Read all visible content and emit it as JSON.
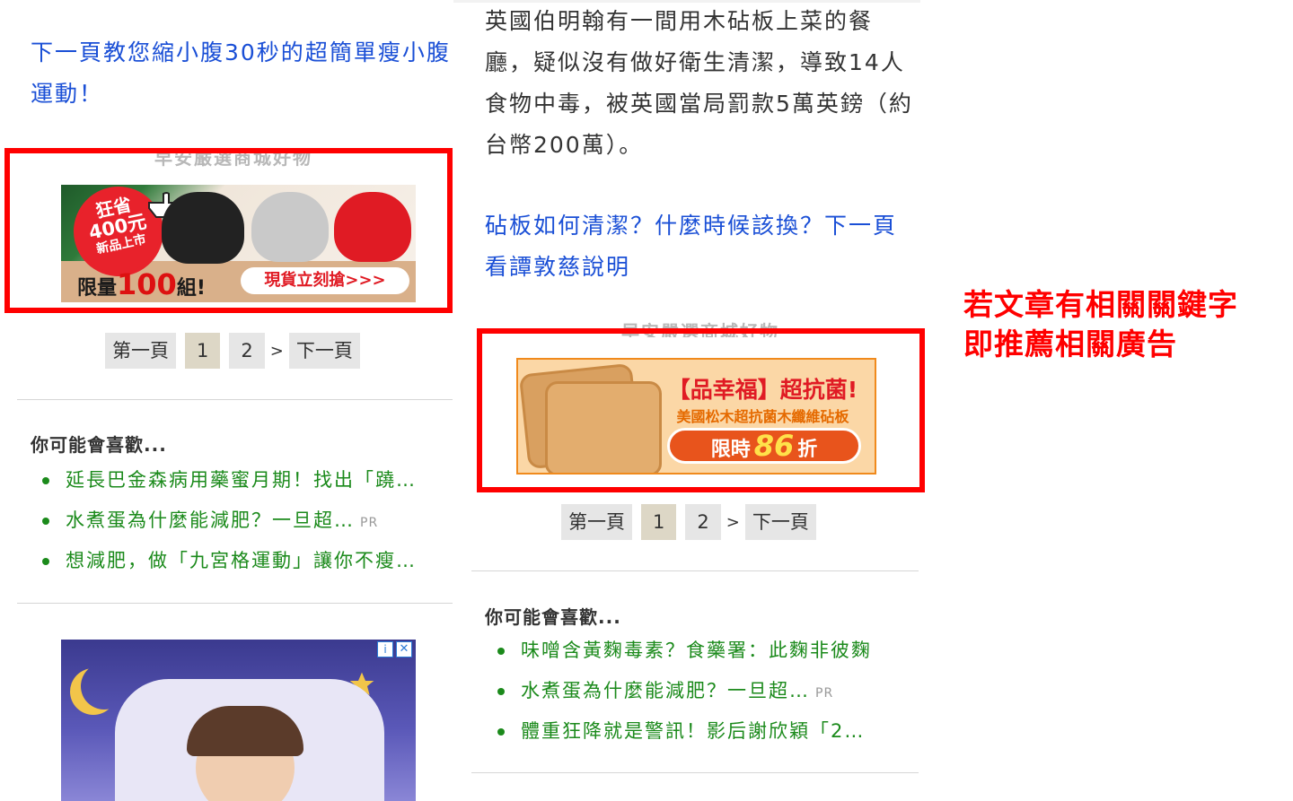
{
  "left": {
    "link_text": "下一頁教您縮小腹30秒的超簡單瘦小腹運動！",
    "ad_caption": "早安嚴選商城好物",
    "ad_banner": {
      "badge_line1": "狂省",
      "badge_line2": "400元",
      "badge_line3": "新品上市",
      "promo_prefix": "限量",
      "promo_number": "100",
      "promo_suffix": "組!",
      "cta_text": "現貨立刻搶>>>"
    },
    "pager": {
      "first": "第一頁",
      "page1": "1",
      "page2": "2",
      "arrow": ">",
      "next": "下一頁"
    },
    "you_may_like": "你可能會喜歡...",
    "related": [
      {
        "text": "延長巴金森病用藥蜜月期！找出「蹺…",
        "pr": ""
      },
      {
        "text": "水煮蛋為什麼能減肥？一旦超…",
        "pr": "PR"
      },
      {
        "text": "想減肥，做「九宮格運動」讓你不瘦…",
        "pr": ""
      }
    ]
  },
  "middle": {
    "paragraph": "英國伯明翰有一間用木砧板上菜的餐廳，疑似沒有做好衛生清潔，導致14人食物中毒，被英國當局罰款5萬英鎊（約台幣200萬）。",
    "link_text": "砧板如何清潔？什麼時候該換？下一頁看譚敦慈說明",
    "ad_caption": "早安嚴選商城好物",
    "ad_banner": {
      "title": "【品幸福】超抗菌!",
      "subtitle": "美國松木超抗菌木纖維砧板",
      "cta_prefix": "限時",
      "cta_number": "86",
      "cta_suffix": "折"
    },
    "pager": {
      "first": "第一頁",
      "page1": "1",
      "page2": "2",
      "arrow": ">",
      "next": "下一頁"
    },
    "you_may_like": "你可能會喜歡...",
    "related": [
      {
        "text": "味噌含黃麴毒素？食藥署：此麴非彼麴",
        "pr": ""
      },
      {
        "text": "水煮蛋為什麼能減肥？一旦超…",
        "pr": "PR"
      },
      {
        "text": "體重狂降就是警訊！影后謝欣穎「2…",
        "pr": ""
      }
    ]
  },
  "annotation": {
    "line1": "若文章有相關關鍵字",
    "line2": "即推薦相關廣告"
  },
  "colors": {
    "link": "#1a4fd6",
    "related_link": "#1b8a1b",
    "highlight_box": "#ff0000",
    "annotation": "#ff0000"
  },
  "icons": [
    "adchoices-icon",
    "close-icon",
    "cursor-hand-icon",
    "moon-icon",
    "star-icon"
  ]
}
